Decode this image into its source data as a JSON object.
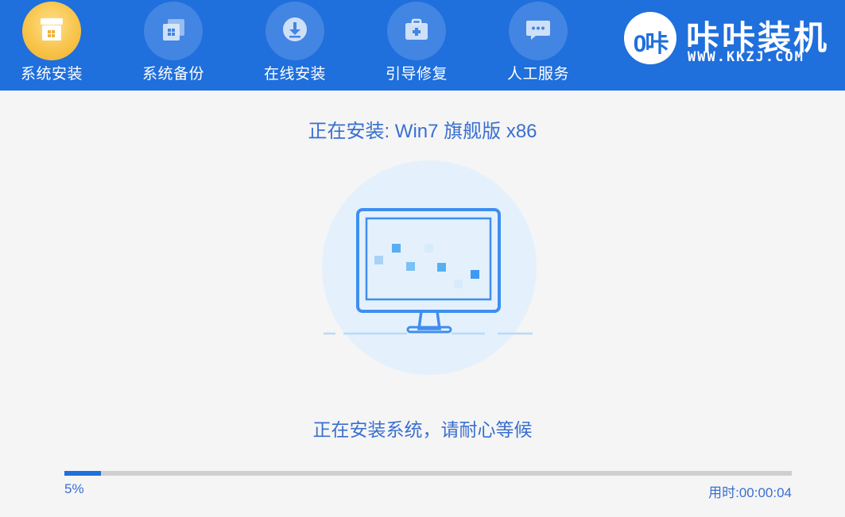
{
  "nav": {
    "items": [
      {
        "label": "系统安装",
        "icon": "box-icon",
        "active": true
      },
      {
        "label": "系统备份",
        "icon": "backup-icon",
        "active": false
      },
      {
        "label": "在线安装",
        "icon": "download-icon",
        "active": false
      },
      {
        "label": "引导修复",
        "icon": "toolbox-icon",
        "active": false
      },
      {
        "label": "人工服务",
        "icon": "chat-icon",
        "active": false
      }
    ]
  },
  "brand": {
    "logo_text": "0咔",
    "name": "咔咔装机",
    "url": "WWW.KKZJ.COM"
  },
  "install": {
    "title": "正在安装: Win7 旗舰版 x86",
    "status": "正在安装系统，请耐心等候"
  },
  "progress": {
    "percent_label": "5%",
    "fraction": 0.05,
    "elapsed": "用时:00:00:04"
  },
  "colors": {
    "header": "#1f6fdc",
    "accent_text": "#3a6fd0",
    "active_tab": "#f7c246"
  }
}
